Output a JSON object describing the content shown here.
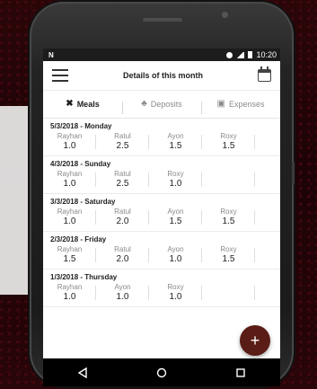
{
  "status_bar": {
    "left_icon": "N",
    "right_text": "10:20",
    "icons": [
      "do-not-disturb-icon",
      "signal-icon",
      "battery-icon"
    ]
  },
  "header": {
    "title": "Details of this month",
    "menu_icon": "menu-icon",
    "calendar_icon": "calendar-icon"
  },
  "tabs": [
    {
      "label": "Meals",
      "icon": "meal-icon",
      "active": true
    },
    {
      "label": "Deposits",
      "icon": "bag-icon",
      "active": false
    },
    {
      "label": "Expenses",
      "icon": "receipt-icon",
      "active": false
    }
  ],
  "days": [
    {
      "date_label": "5/3/2018 - Monday",
      "members": [
        {
          "name": "Rayhan",
          "value": "1.0"
        },
        {
          "name": "Ratul",
          "value": "2.5"
        },
        {
          "name": "Ayon",
          "value": "1.5"
        },
        {
          "name": "Roxy",
          "value": "1.5"
        }
      ]
    },
    {
      "date_label": "4/3/2018 - Sunday",
      "members": [
        {
          "name": "Rayhan",
          "value": "1.0"
        },
        {
          "name": "Ratul",
          "value": "2.5"
        },
        {
          "name": "Roxy",
          "value": "1.0"
        },
        {
          "name": "",
          "value": ""
        }
      ]
    },
    {
      "date_label": "3/3/2018 - Saturday",
      "members": [
        {
          "name": "Rayhan",
          "value": "1.0"
        },
        {
          "name": "Ratul",
          "value": "2.0"
        },
        {
          "name": "Ayon",
          "value": "1.5"
        },
        {
          "name": "Roxy",
          "value": "1.5"
        }
      ]
    },
    {
      "date_label": "2/3/2018 - Friday",
      "members": [
        {
          "name": "Rayhan",
          "value": "1.5"
        },
        {
          "name": "Ratul",
          "value": "2.0"
        },
        {
          "name": "Ayon",
          "value": "1.0"
        },
        {
          "name": "Roxy",
          "value": "1.5"
        }
      ]
    },
    {
      "date_label": "1/3/2018 - Thursday",
      "members": [
        {
          "name": "Rayhan",
          "value": "1.0"
        },
        {
          "name": "Ayon",
          "value": "1.0"
        },
        {
          "name": "Roxy",
          "value": "1.0"
        },
        {
          "name": "",
          "value": ""
        }
      ]
    }
  ],
  "fab": {
    "label": "+",
    "icon": "plus-icon"
  },
  "navigation": {
    "buttons": [
      "back-icon",
      "home-icon",
      "recents-icon"
    ]
  }
}
